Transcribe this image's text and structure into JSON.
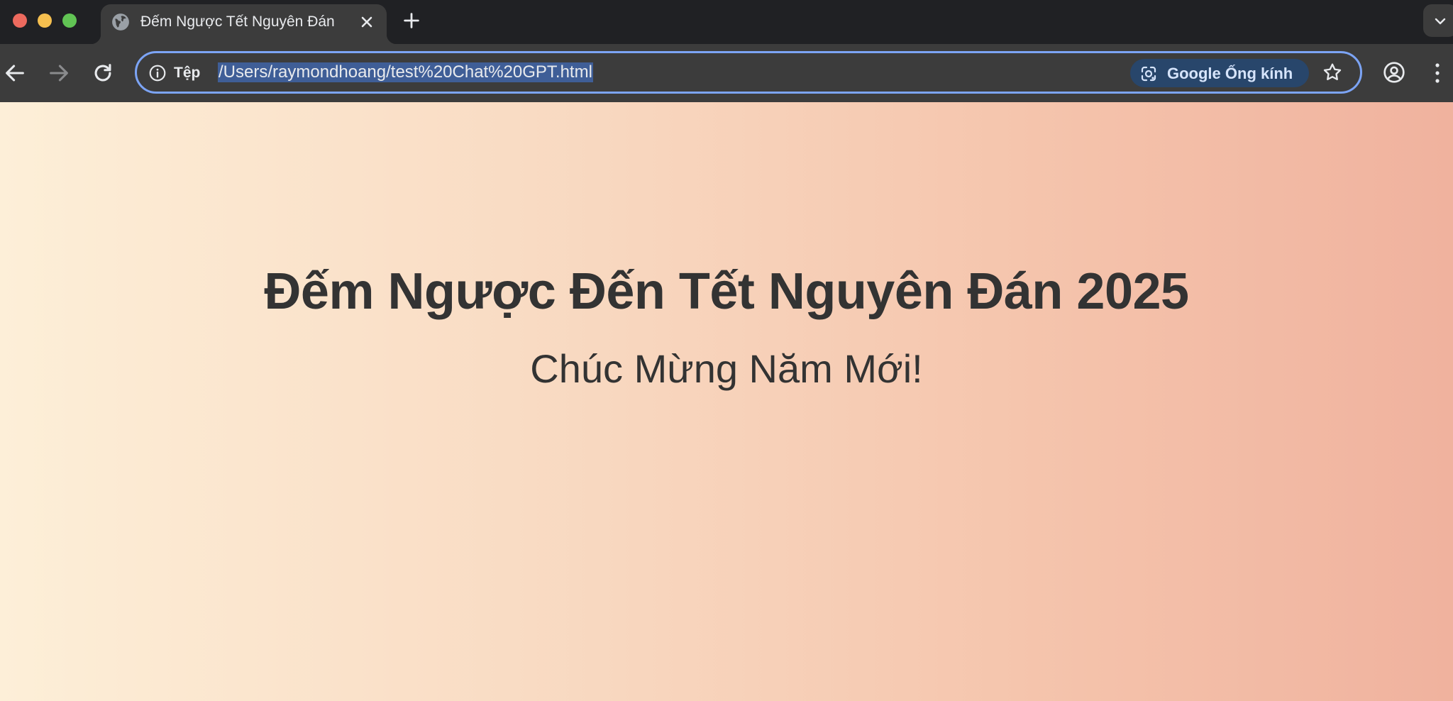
{
  "tab": {
    "title": "Đếm Ngược Tết Nguyên Đán"
  },
  "omnibox": {
    "site_info_label": "Tệp",
    "url": "/Users/raymondhoang/test%20Chat%20GPT.html",
    "lens_label": "Google Ống kính"
  },
  "page": {
    "headline": "Đếm Ngược Đến Tết Nguyên Đán 2025",
    "greeting": "Chúc Mừng Năm Mới!"
  },
  "colors": {
    "accent_outline": "#7ca4f5",
    "url_selection": "#3f5e97",
    "gradient_start": "#fdefd8",
    "gradient_end": "#f0b29e",
    "text": "#333333"
  },
  "icons": [
    "globe-icon",
    "close-icon",
    "plus-icon",
    "chevron-down-icon",
    "back-arrow-icon",
    "forward-arrow-icon",
    "reload-icon",
    "info-icon",
    "lens-icon",
    "star-icon",
    "profile-icon",
    "kebab-menu-icon"
  ]
}
